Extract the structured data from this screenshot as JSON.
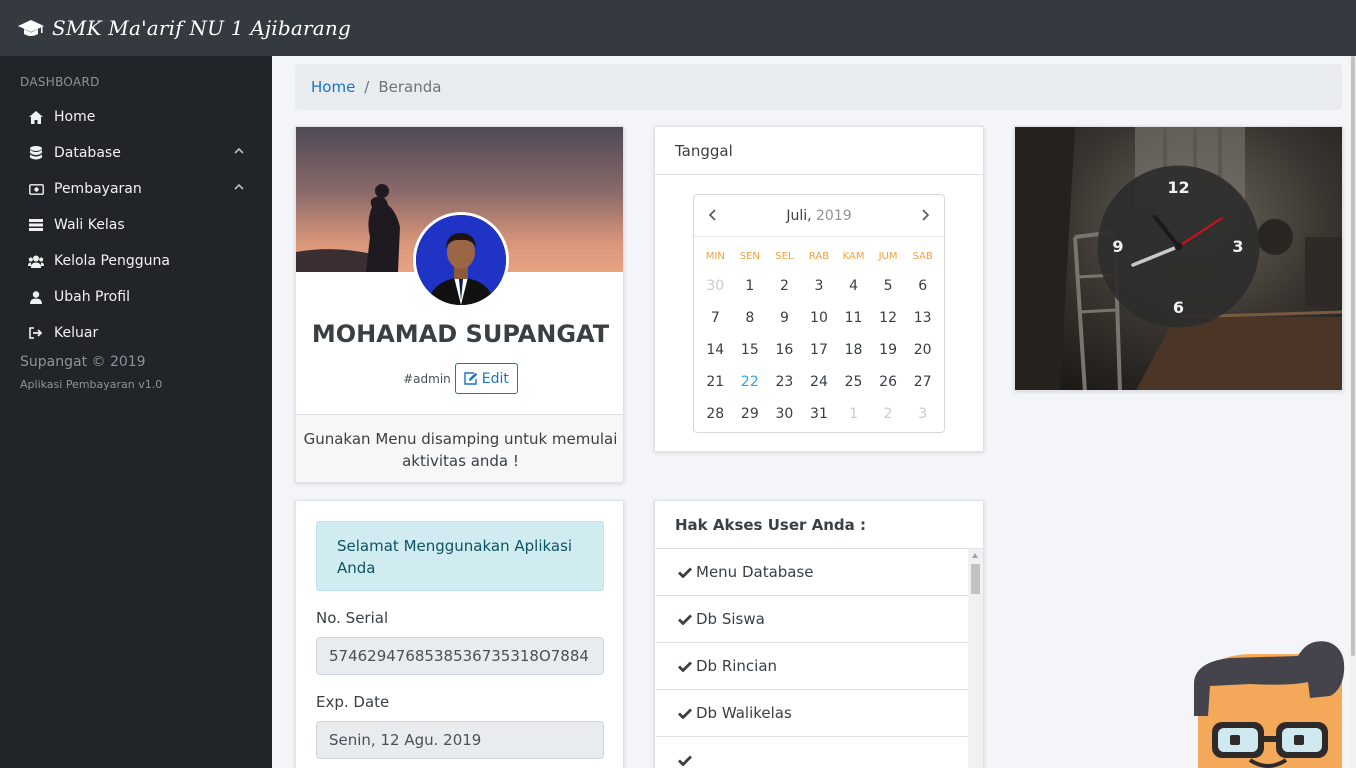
{
  "app": {
    "title": "SMK Ma'arif NU 1 Ajibarang"
  },
  "sidebar": {
    "heading": "DASHBOARD",
    "items": [
      {
        "label": "Home",
        "icon": "home-icon",
        "has_submenu": false
      },
      {
        "label": "Database",
        "icon": "database-icon",
        "has_submenu": true
      },
      {
        "label": "Pembayaran",
        "icon": "money-icon",
        "has_submenu": true
      },
      {
        "label": "Wali Kelas",
        "icon": "list-icon",
        "has_submenu": false
      },
      {
        "label": "Kelola Pengguna",
        "icon": "users-icon",
        "has_submenu": false
      },
      {
        "label": "Ubah Profil",
        "icon": "user-icon",
        "has_submenu": false
      },
      {
        "label": "Keluar",
        "icon": "sign-out-icon",
        "has_submenu": false
      }
    ],
    "footer_copyright": "Supangat © 2019",
    "footer_app": "Aplikasi Pembayaran v1.0"
  },
  "breadcrumb": {
    "home": "Home",
    "separator": "/",
    "current": "Beranda"
  },
  "profile": {
    "name": "MOHAMAD SUPANGAT",
    "role": "#admin",
    "edit_label": "Edit",
    "footer_text": "Gunakan Menu disamping untuk memulai aktivitas anda !"
  },
  "calendar": {
    "card_title": "Tanggal",
    "month": "Juli,",
    "year": "2019",
    "weekdays": [
      "MIN",
      "SEN",
      "SEL",
      "RAB",
      "KAM",
      "JUM",
      "SAB"
    ],
    "weeks": [
      [
        "30",
        "1",
        "2",
        "3",
        "4",
        "5",
        "6"
      ],
      [
        "7",
        "8",
        "9",
        "10",
        "11",
        "12",
        "13"
      ],
      [
        "14",
        "15",
        "16",
        "17",
        "18",
        "19",
        "20"
      ],
      [
        "21",
        "22",
        "23",
        "24",
        "25",
        "26",
        "27"
      ],
      [
        "28",
        "29",
        "30",
        "31",
        "1",
        "2",
        "3"
      ]
    ],
    "today": "22"
  },
  "clock": {
    "numerals": [
      "12",
      "3",
      "6",
      "9"
    ],
    "hour_hand_color": "#222222",
    "second_hand_color": "#d0101a"
  },
  "info": {
    "welcome": "Selamat Menggunakan Aplikasi Anda",
    "serial_label": "No. Serial",
    "serial_value": "5746294768538536735318O7884",
    "exp_label": "Exp. Date",
    "exp_value": "Senin, 12 Agu. 2019"
  },
  "access": {
    "title": "Hak Akses User Anda :",
    "items": [
      "Menu Database",
      "Db Siswa",
      "Db Rincian",
      "Db Walikelas",
      ""
    ]
  },
  "colors": {
    "topbar": "#343a40",
    "sidebar": "#212529",
    "accent": "#1a73c8",
    "calendar_weekday": "#f0a13c"
  }
}
